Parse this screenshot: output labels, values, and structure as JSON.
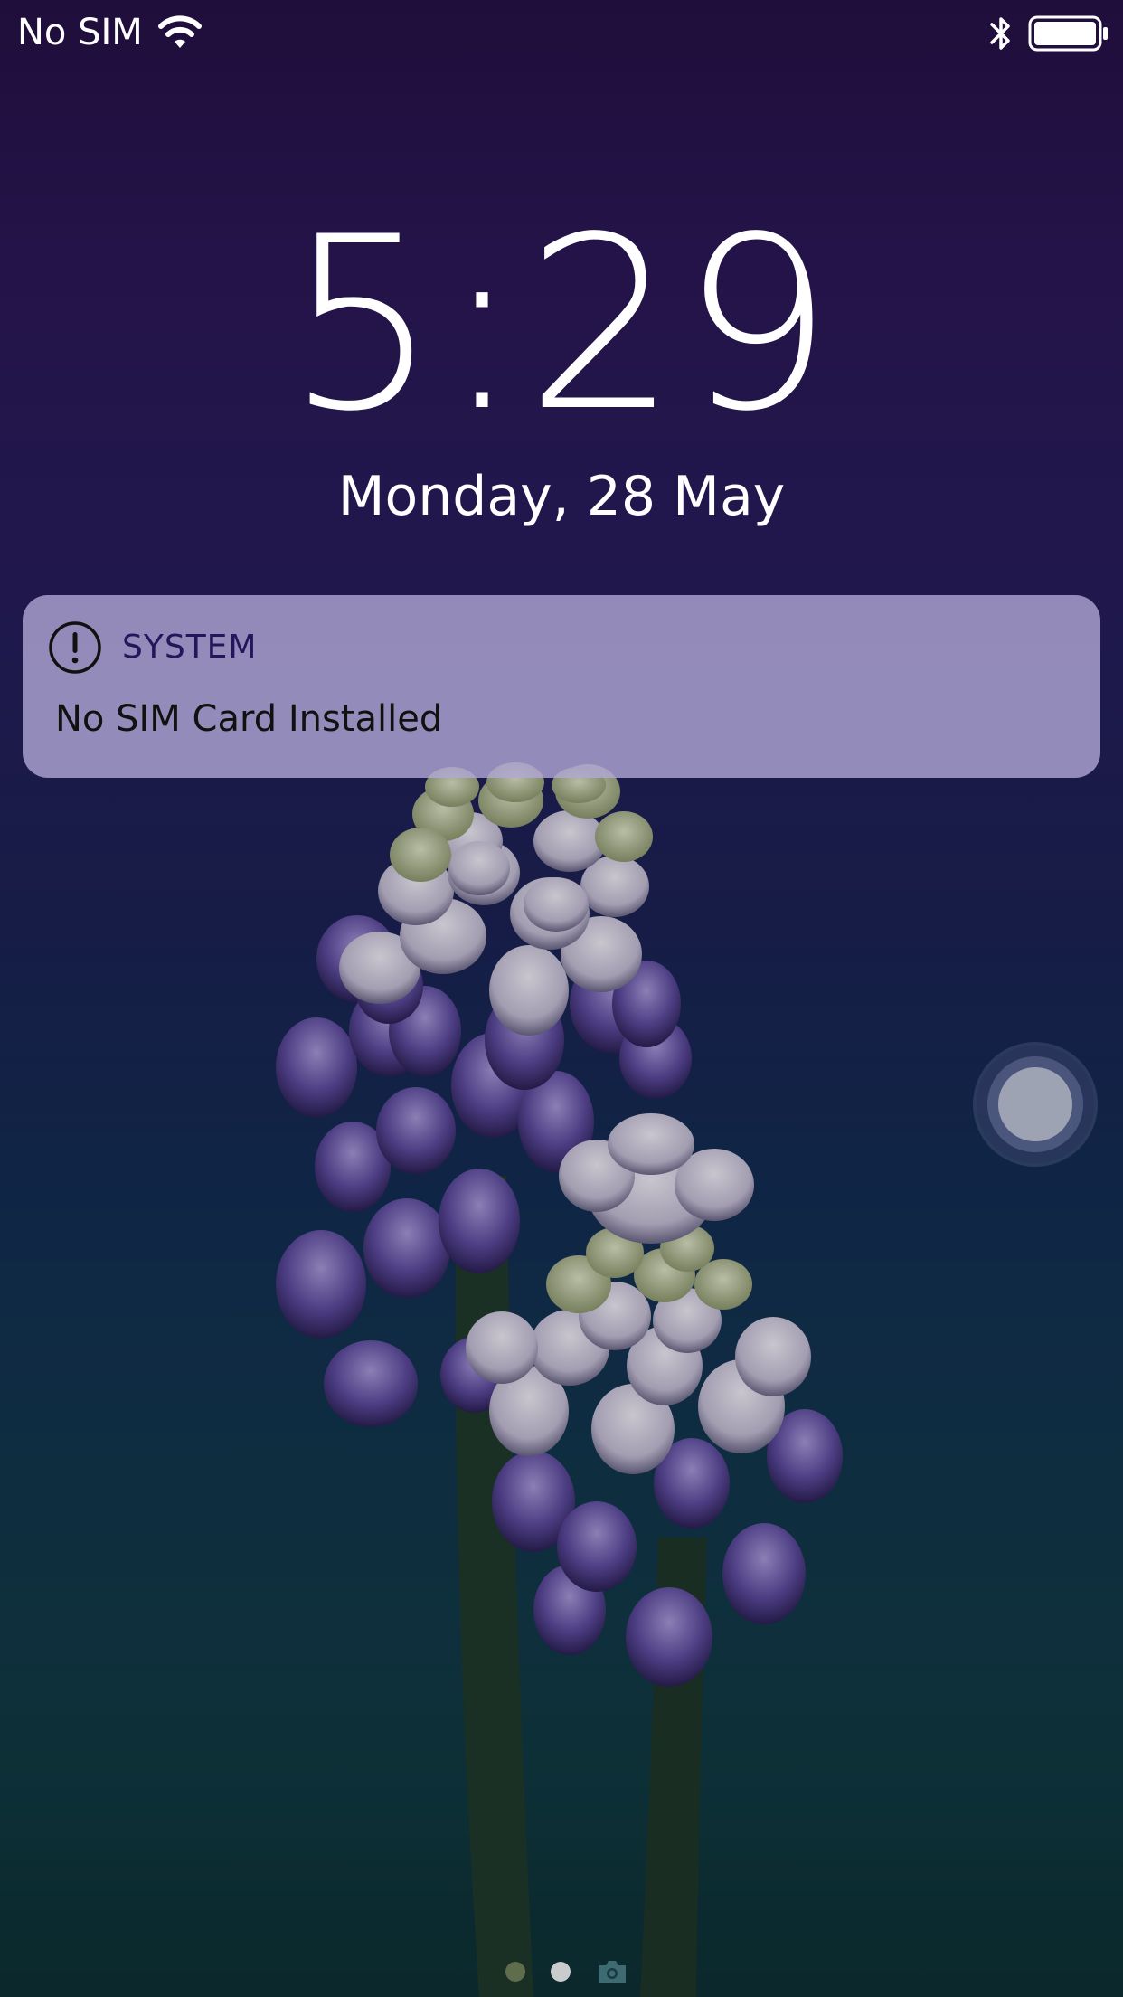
{
  "status_bar": {
    "carrier": "No SIM",
    "icons": [
      "wifi-icon",
      "bluetooth-icon",
      "battery-icon"
    ],
    "battery_level": 1.0
  },
  "lock_screen": {
    "time": "5:29",
    "date": "Monday, 28 May"
  },
  "notification": {
    "app_name": "SYSTEM",
    "icon": "exclamation-circle-icon",
    "message": "No SIM Card Installed"
  },
  "page_indicator": {
    "pages": 2,
    "current": 2,
    "icons": [
      "page-dot",
      "page-dot",
      "camera-icon"
    ]
  },
  "colors": {
    "notification_bg": "#b2a8d6",
    "notification_app": "#24165a",
    "text": "#ffffff"
  }
}
